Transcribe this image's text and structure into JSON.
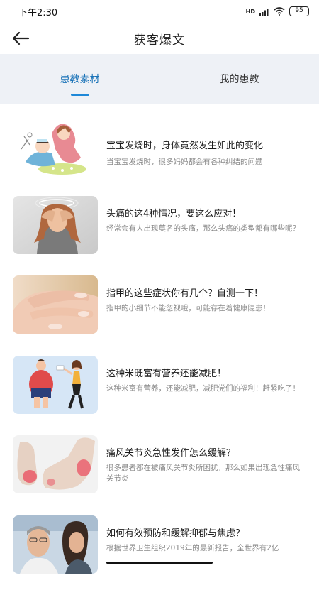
{
  "status_bar": {
    "time": "下午2:30",
    "network": "HD",
    "battery": "95"
  },
  "header": {
    "title": "获客爆文"
  },
  "tabs": [
    {
      "label": "患教素材",
      "active": true
    },
    {
      "label": "我的患教",
      "active": false
    }
  ],
  "articles": [
    {
      "title": "宝宝发烧时，身体竟然发生如此的变化",
      "desc": "当宝宝发烧时，很多妈妈都会有各种纠结的问题",
      "image": "baby-fever-illustration"
    },
    {
      "title": "头痛的这4种情况，要这么应对！",
      "desc": "经常会有人出现莫名的头痛，那么头痛的类型都有哪些呢？",
      "image": "headache-photo"
    },
    {
      "title": "指甲的这些症状你有几个？自测一下！",
      "desc": "指甲的小细节不能忽视哦，可能存在着健康隐患！",
      "image": "fingernail-photo"
    },
    {
      "title": "这种米既富有营养还能减肥！",
      "desc": "这种米富有营养，还能减肥，减肥党们的福利！赶紧吃了！",
      "image": "weight-loss-illustration"
    },
    {
      "title": "痛风关节炎急性发作怎么缓解？",
      "desc": "很多患者都在被痛风关节炎所困扰，那么如果出现急性痛风关节炎",
      "image": "gout-foot-photo"
    },
    {
      "title": "如何有效预防和缓解抑郁与焦虑？",
      "desc": "根据世界卫生组织2019年的最新报告，全世界有2亿",
      "image": "depression-photo"
    }
  ],
  "colors": {
    "accent": "#1e88d8",
    "tab_bg": "#eef1f6"
  }
}
